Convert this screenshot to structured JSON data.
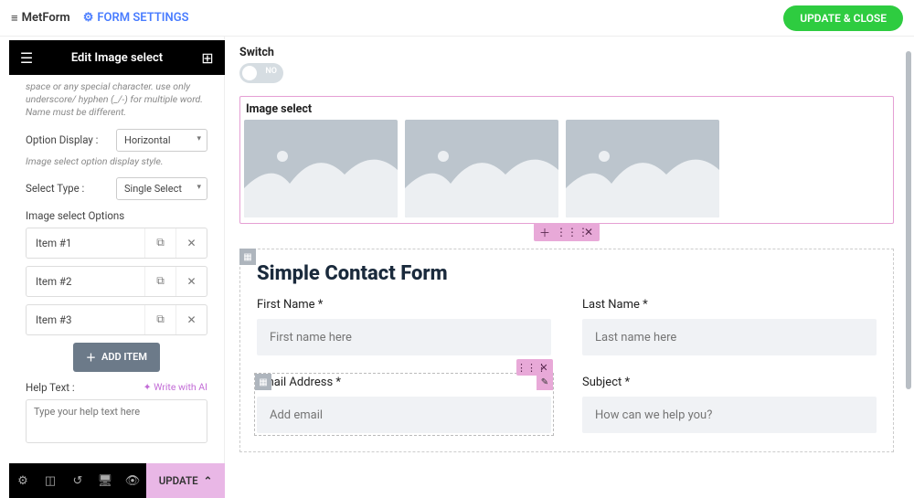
{
  "topbar": {
    "brand": "MetForm",
    "form_settings": "FORM SETTINGS",
    "update_close": "UPDATE & CLOSE"
  },
  "panel": {
    "title": "Edit Image select",
    "name_hint": "space or any special character. use only underscore/ hyphen (_/-) for multiple word. Name must be different.",
    "option_display_label": "Option Display :",
    "option_display_value": "Horizontal",
    "option_display_help": "Image select option display style.",
    "select_type_label": "Select Type :",
    "select_type_value": "Single Select",
    "options_label": "Image select Options",
    "options": [
      {
        "label": "Item #1"
      },
      {
        "label": "Item #2"
      },
      {
        "label": "Item #3"
      }
    ],
    "add_item": "ADD ITEM",
    "help_text_label": "Help Text :",
    "write_ai": "✦ Write with AI",
    "help_placeholder": "Type your help text here"
  },
  "footer": {
    "update": "UPDATE"
  },
  "canvas": {
    "switch_label": "Switch",
    "switch_value": "NO",
    "image_select_title": "Image select",
    "form_title": "Simple Contact Form",
    "fields": {
      "first_name_label": "First Name *",
      "first_name_ph": "First name here",
      "last_name_label": "Last Name *",
      "last_name_ph": "Last name here",
      "email_label": "Email Address *",
      "email_ph": "Add email",
      "subject_label": "Subject *",
      "subject_ph": "How can we help you?"
    }
  }
}
